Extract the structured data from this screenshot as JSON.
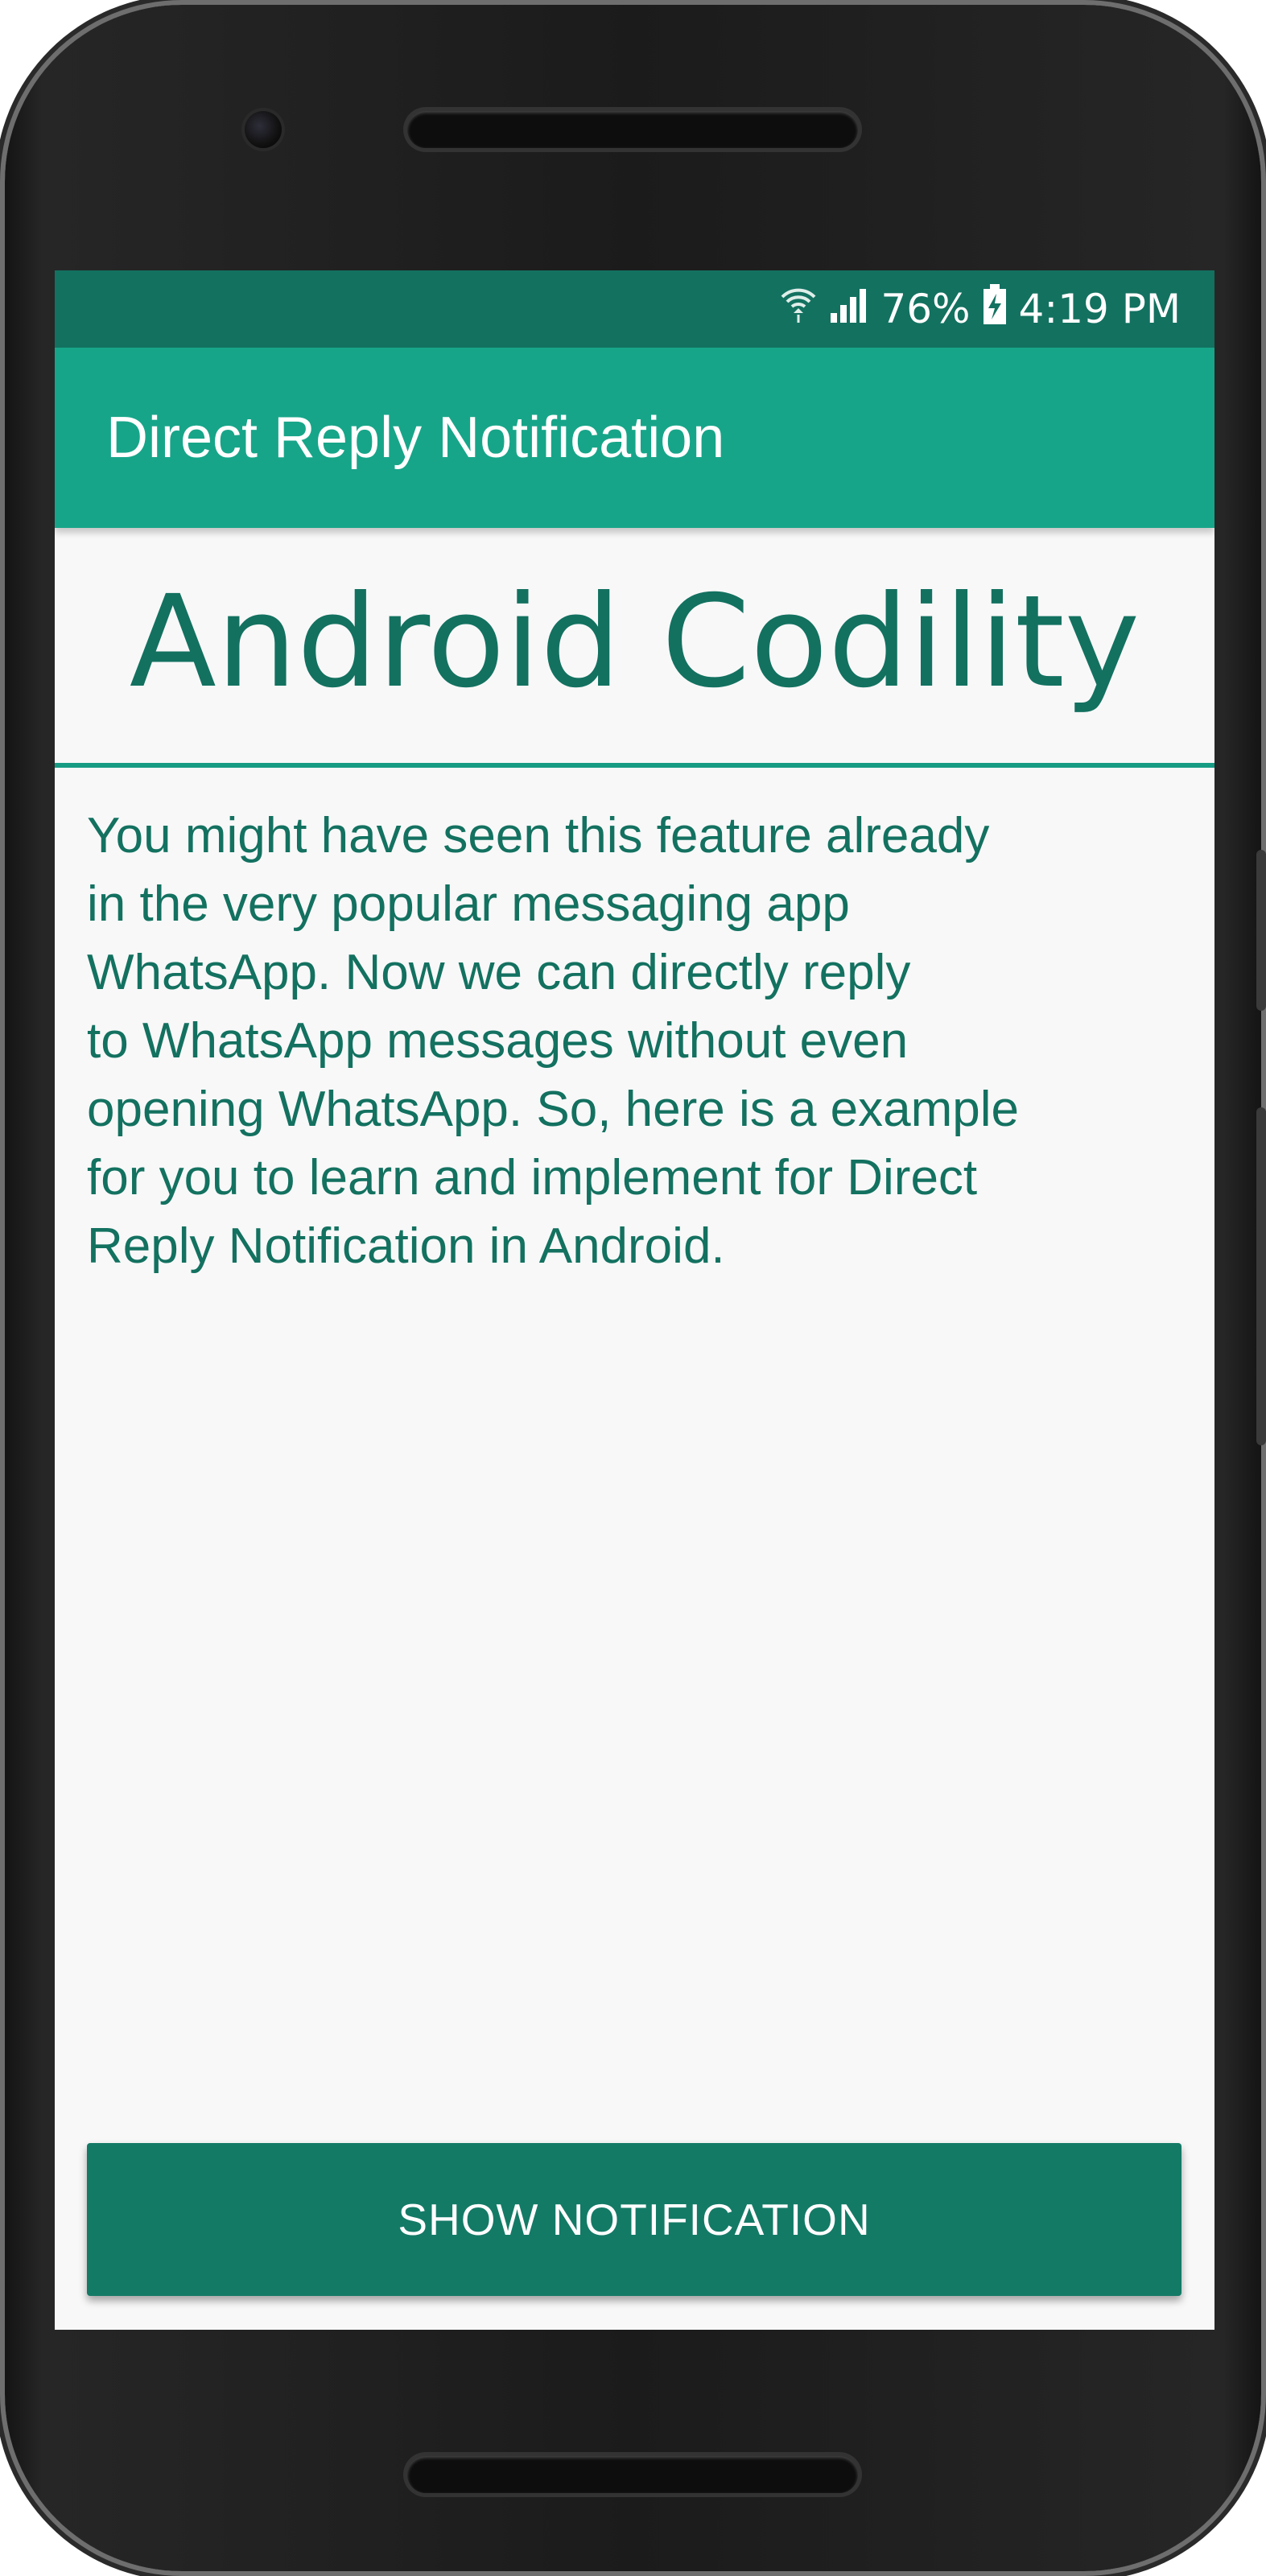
{
  "status_bar": {
    "battery": "76%",
    "time": "4:19 PM",
    "icons": [
      "wifi-icon",
      "signal-icon",
      "battery-charging-icon"
    ]
  },
  "app_bar": {
    "title": "Direct Reply Notification"
  },
  "content": {
    "heading": "Android Codility",
    "body_lines": [
      "You might have seen this feature already",
      "in the very popular messaging app",
      "WhatsApp. Now we can directly reply",
      "to WhatsApp messages without even",
      "opening WhatsApp. So, here is a example",
      "for you to learn and implement for Direct",
      "Reply Notification in Android."
    ]
  },
  "actions": {
    "show_notification": "SHOW NOTIFICATION"
  },
  "colors": {
    "status_bar": "#137160",
    "app_bar": "#17a589",
    "accent_text": "#137160",
    "button": "#137a66",
    "background": "#f8f8f8"
  }
}
